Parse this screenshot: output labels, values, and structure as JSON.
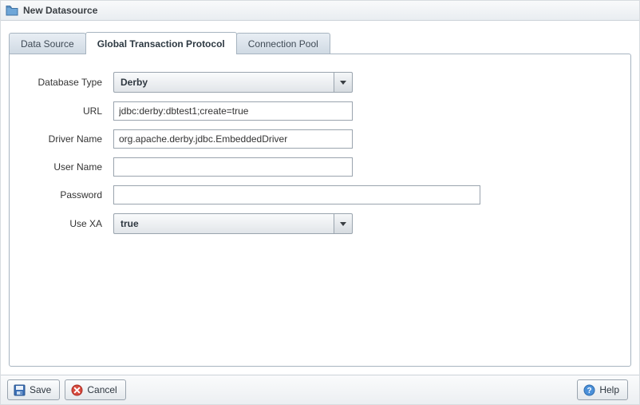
{
  "window": {
    "title": "New Datasource"
  },
  "tabs": {
    "data_source": "Data Source",
    "global_transaction_protocol": "Global Transaction Protocol",
    "connection_pool": "Connection Pool"
  },
  "form": {
    "database_type": {
      "label": "Database Type",
      "value": "Derby"
    },
    "url": {
      "label": "URL",
      "value": "jdbc:derby:dbtest1;create=true"
    },
    "driver_name": {
      "label": "Driver Name",
      "value": "org.apache.derby.jdbc.EmbeddedDriver"
    },
    "user_name": {
      "label": "User Name",
      "value": ""
    },
    "password": {
      "label": "Password",
      "value": ""
    },
    "use_xa": {
      "label": "Use XA",
      "value": "true"
    }
  },
  "footer": {
    "save": "Save",
    "cancel": "Cancel",
    "help": "Help"
  }
}
